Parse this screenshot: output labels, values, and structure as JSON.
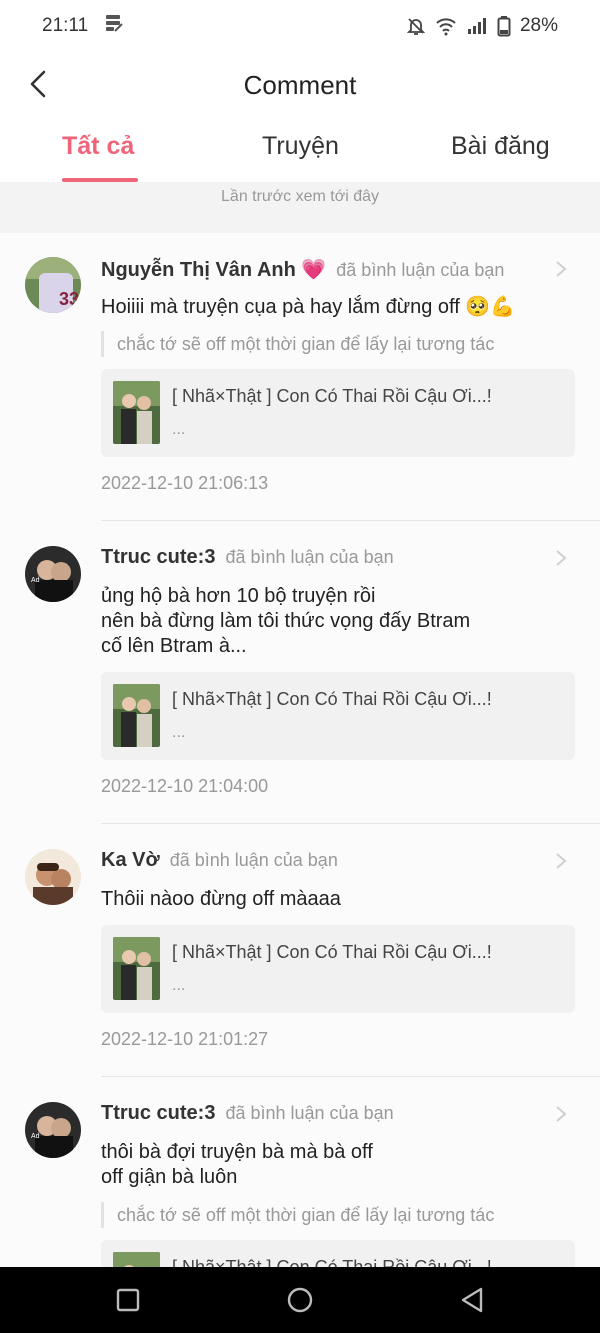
{
  "status_bar": {
    "time": "21:11",
    "battery": "28%",
    "icons": [
      "storage-icon",
      "mute-icon",
      "wifi-icon",
      "signal-icon",
      "battery-icon"
    ]
  },
  "header": {
    "title": "Comment",
    "back_icon": "chevron-left-icon"
  },
  "tabs": [
    {
      "label": "Tất cả",
      "active": true
    },
    {
      "label": "Truyện",
      "active": false
    },
    {
      "label": "Bài đăng",
      "active": false
    }
  ],
  "last_seen": "Lần trước xem tới đây",
  "colors": {
    "accent": "#f0647a",
    "muted": "#999999",
    "card": "#f1f1f1"
  },
  "comments": [
    {
      "user": "Nguyễn Thị Vân Anh 💗",
      "action": "đã bình luận của bạn",
      "lines": [
        "Hoiiii mà truyện cụa pà hay lắm đừng off 🥺💪"
      ],
      "quote": "chắc tớ sẽ off một thời gian để lấy lại tương tác",
      "story_title": "[ Nhã×Thật ] Con Có Thai Rồi Cậu Ơi...!",
      "story_more": "...",
      "time": "2022-12-10 21:06:13"
    },
    {
      "user": "Ttruc cute:3",
      "action": "đã bình luận của bạn",
      "lines": [
        "ủng hộ bà hơn 10 bộ truyện rồi",
        "nên bà đừng làm tôi thức vọng đấy Btram",
        "cố lên Btram à..."
      ],
      "quote": "",
      "story_title": "[ Nhã×Thật ] Con Có Thai Rồi Cậu Ơi...!",
      "story_more": "...",
      "time": "2022-12-10 21:04:00"
    },
    {
      "user": "Ka Vờ",
      "action": "đã bình luận của bạn",
      "lines": [
        "Thôii nàoo đừng off màaaa"
      ],
      "quote": "",
      "story_title": "[ Nhã×Thật ] Con Có Thai Rồi Cậu Ơi...!",
      "story_more": "...",
      "time": "2022-12-10 21:01:27"
    },
    {
      "user": "Ttruc cute:3",
      "action": "đã bình luận của bạn",
      "lines": [
        "thôi bà đợi truyện bà mà bà off",
        "off giận bà luôn"
      ],
      "quote": "chắc tớ sẽ off một thời gian để lấy lại tương tác",
      "story_title": "[ Nhã×Thật ] Con Có Thai Rồi Cậu Ơi...!",
      "story_more": "",
      "time": ""
    }
  ],
  "nav": [
    "recents-square-icon",
    "home-circle-icon",
    "back-triangle-icon"
  ]
}
